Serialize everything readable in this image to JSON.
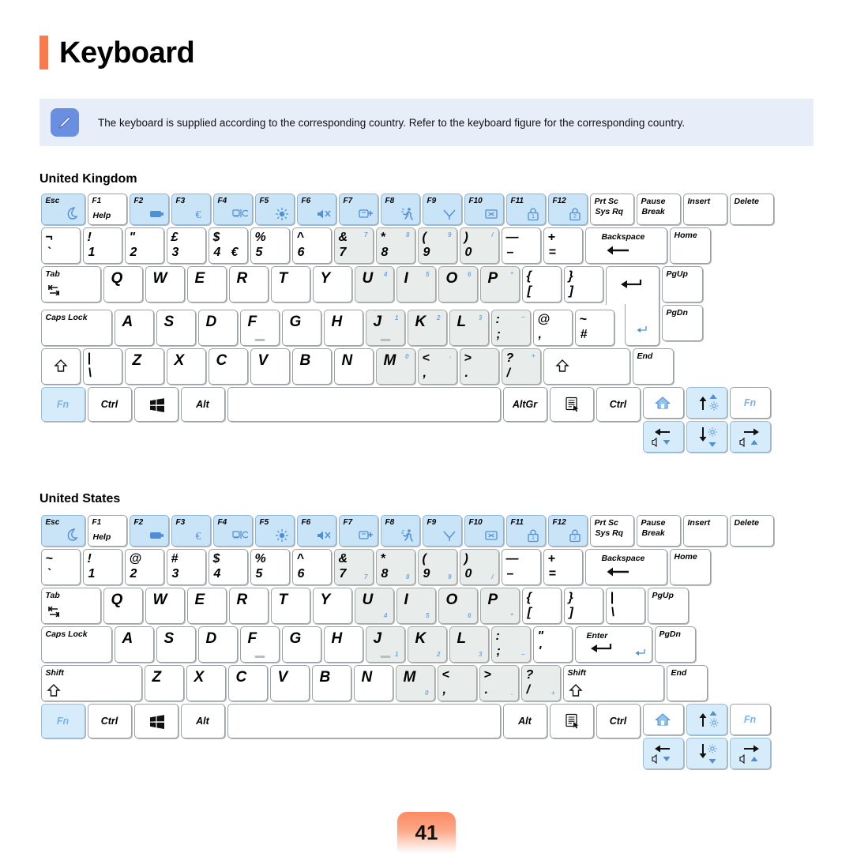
{
  "page": {
    "title": "Keyboard",
    "page_number": "41",
    "accent_color": "#f97a4d",
    "note_bg": "#e8eef9",
    "fn_key_color": "#c9e3f7",
    "numpad_key_color": "#e8ecea",
    "blue_label_color": "#6fa8e8"
  },
  "note": {
    "icon": "pencil-note-icon",
    "text": "The keyboard is supplied according to the corresponding country. Refer to the keyboard figure for the corresponding country."
  },
  "sections": [
    {
      "id": "uk",
      "title": "United Kingdom"
    },
    {
      "id": "us",
      "title": "United States"
    }
  ],
  "function_row": {
    "esc": {
      "top": "Esc",
      "icon": "moon-sleep-icon"
    },
    "keys": [
      {
        "top": "F1",
        "sub": "Help",
        "icon": "",
        "blue": false
      },
      {
        "top": "F2",
        "sub": "",
        "icon": "battery-icon",
        "blue": true
      },
      {
        "top": "F3",
        "sub": "",
        "icon": "euro-icon",
        "blue": true
      },
      {
        "top": "F4",
        "sub": "",
        "icon": "display-switch-icon",
        "blue": true
      },
      {
        "top": "F5",
        "sub": "",
        "icon": "brightness-icon",
        "blue": true
      },
      {
        "top": "F6",
        "sub": "",
        "icon": "mute-icon",
        "blue": true
      },
      {
        "top": "F7",
        "sub": "",
        "icon": "device-add-icon",
        "blue": true
      },
      {
        "top": "F8",
        "sub": "",
        "icon": "performance-runner-icon",
        "blue": true
      },
      {
        "top": "F9",
        "sub": "",
        "icon": "wireless-icon",
        "blue": true
      },
      {
        "top": "F10",
        "sub": "",
        "icon": "touchpad-off-icon",
        "blue": true
      },
      {
        "top": "F11",
        "sub": "",
        "icon": "lock-icon",
        "blue": true
      },
      {
        "top": "F12",
        "sub": "",
        "icon": "secure-lock-icon",
        "blue": true
      }
    ],
    "right": [
      {
        "l1": "Prt Sc",
        "l2": "Sys Rq"
      },
      {
        "l1": "Pause",
        "l2": "Break"
      },
      {
        "l1": "Insert",
        "l2": ""
      },
      {
        "l1": "Delete",
        "l2": ""
      }
    ]
  },
  "uk": {
    "row_num": [
      {
        "tl": "¬",
        "bl": "`",
        "bc": "¦",
        "grey": false
      },
      {
        "tl": "!",
        "bl": "1",
        "grey": false
      },
      {
        "tl": "\"",
        "bl": "2",
        "grey": false
      },
      {
        "tl": "£",
        "bl": "3",
        "grey": false
      },
      {
        "tl": "$",
        "bl": "4",
        "bx": "€",
        "grey": false
      },
      {
        "tl": "%",
        "bl": "5",
        "grey": false
      },
      {
        "tl": "^",
        "bl": "6",
        "grey": false
      },
      {
        "tl": "&",
        "bl": "7",
        "np": "7",
        "grey": true
      },
      {
        "tl": "*",
        "bl": "8",
        "np": "8",
        "grey": true
      },
      {
        "tl": "(",
        "bl": "9",
        "np": "9",
        "grey": true
      },
      {
        "tl": ")",
        "bl": "0",
        "np": "/",
        "grey": true
      },
      {
        "tl": "—",
        "bl": "–",
        "grey": false
      },
      {
        "tl": "+",
        "bl": "=",
        "grey": false
      }
    ],
    "backspace": "Backspace",
    "row_q": {
      "tab": "Tab",
      "keys": [
        {
          "c": "Q"
        },
        {
          "c": "W"
        },
        {
          "c": "E"
        },
        {
          "c": "R"
        },
        {
          "c": "T"
        },
        {
          "c": "Y"
        },
        {
          "c": "U",
          "np": "4",
          "grey": true
        },
        {
          "c": "I",
          "np": "5",
          "grey": true
        },
        {
          "c": "O",
          "np": "6",
          "grey": true
        },
        {
          "c": "P",
          "np": "*",
          "grey": true
        },
        {
          "tl": "{",
          "bl": "["
        },
        {
          "tl": "}",
          "bl": "]"
        }
      ]
    },
    "row_a": {
      "caps": "Caps Lock",
      "keys": [
        {
          "c": "A"
        },
        {
          "c": "S"
        },
        {
          "c": "D"
        },
        {
          "c": "F",
          "bump": true
        },
        {
          "c": "G"
        },
        {
          "c": "H"
        },
        {
          "c": "J",
          "np": "1",
          "grey": true,
          "bump": true
        },
        {
          "c": "K",
          "np": "2",
          "grey": true
        },
        {
          "c": "L",
          "np": "3",
          "grey": true
        },
        {
          "tl": ":",
          "bl": ";",
          "np": "−",
          "grey": true
        },
        {
          "tl": "@",
          "bl": ","
        },
        {
          "tl": "~",
          "bl": "#"
        }
      ]
    },
    "row_z": {
      "shift_icon": "shift-arrow-icon",
      "keys": [
        {
          "tl": "|",
          "bl": "\\"
        },
        {
          "c": "Z"
        },
        {
          "c": "X"
        },
        {
          "c": "C"
        },
        {
          "c": "V"
        },
        {
          "c": "B"
        },
        {
          "c": "N"
        },
        {
          "c": "M",
          "np": "0",
          "grey": true
        },
        {
          "tl": "<",
          "bl": ",",
          "np": ".",
          "grey": true
        },
        {
          "tl": ">",
          "bl": ".",
          "grey": true
        },
        {
          "tl": "?",
          "bl": "/",
          "np": "+",
          "grey": true
        }
      ],
      "rshift_icon": "shift-arrow-icon"
    },
    "row_bottom": {
      "fn": "Fn",
      "ctrl": "Ctrl",
      "win": "windows-logo-icon",
      "alt": "Alt",
      "space": "",
      "altgr": "AltGr",
      "menu": "context-menu-icon",
      "rctrl": "Ctrl",
      "fn_right": "Fn"
    },
    "nav_right": [
      "Home",
      "PgUp",
      "PgDn",
      "End"
    ],
    "arrows": {
      "home": "home-icon",
      "up": "arrow-up-brightness-up-icon",
      "left": "arrow-left-volume-down-icon",
      "down": "arrow-down-brightness-down-icon",
      "right": "arrow-right-volume-up-icon"
    }
  },
  "us": {
    "row_num": [
      {
        "tl": "~",
        "bl": "`",
        "grey": false
      },
      {
        "tl": "!",
        "bl": "1",
        "grey": false
      },
      {
        "tl": "@",
        "bl": "2",
        "grey": false
      },
      {
        "tl": "#",
        "bl": "3",
        "grey": false
      },
      {
        "tl": "$",
        "bl": "4",
        "grey": false
      },
      {
        "tl": "%",
        "bl": "5",
        "grey": false
      },
      {
        "tl": "^",
        "bl": "6",
        "grey": false
      },
      {
        "tl": "&",
        "bl": "7",
        "np": "7",
        "grey": true
      },
      {
        "tl": "*",
        "bl": "8",
        "np": "8",
        "grey": true
      },
      {
        "tl": "(",
        "bl": "9",
        "np": "9",
        "grey": true
      },
      {
        "tl": ")",
        "bl": "0",
        "np": "/",
        "grey": true
      },
      {
        "tl": "—",
        "bl": "–",
        "grey": false
      },
      {
        "tl": "+",
        "bl": "=",
        "grey": false
      }
    ],
    "backspace": "Backspace",
    "row_q": {
      "tab": "Tab",
      "keys": [
        {
          "c": "Q"
        },
        {
          "c": "W"
        },
        {
          "c": "E"
        },
        {
          "c": "R"
        },
        {
          "c": "T"
        },
        {
          "c": "Y"
        },
        {
          "c": "U",
          "np": "4",
          "grey": true
        },
        {
          "c": "I",
          "np": "5",
          "grey": true
        },
        {
          "c": "O",
          "np": "6",
          "grey": true
        },
        {
          "c": "P",
          "np": "*",
          "grey": true
        },
        {
          "tl": "{",
          "bl": "["
        },
        {
          "tl": "}",
          "bl": "]"
        },
        {
          "tl": "|",
          "bl": "\\"
        }
      ]
    },
    "row_a": {
      "caps": "Caps Lock",
      "keys": [
        {
          "c": "A"
        },
        {
          "c": "S"
        },
        {
          "c": "D"
        },
        {
          "c": "F",
          "bump": true
        },
        {
          "c": "G"
        },
        {
          "c": "H"
        },
        {
          "c": "J",
          "np": "1",
          "grey": true,
          "bump": true
        },
        {
          "c": "K",
          "np": "2",
          "grey": true
        },
        {
          "c": "L",
          "np": "3",
          "grey": true
        },
        {
          "tl": ":",
          "bl": ";",
          "np": "−",
          "grey": true
        },
        {
          "tl": "\"",
          "bl": "'"
        }
      ],
      "enter": "Enter"
    },
    "row_z": {
      "shift": "Shift",
      "keys": [
        {
          "c": "Z"
        },
        {
          "c": "X"
        },
        {
          "c": "C"
        },
        {
          "c": "V"
        },
        {
          "c": "B"
        },
        {
          "c": "N"
        },
        {
          "c": "M",
          "np": "0",
          "grey": true
        },
        {
          "tl": "<",
          "bl": ",",
          "grey": true
        },
        {
          "tl": ">",
          "bl": ".",
          "np": ".",
          "grey": true
        },
        {
          "tl": "?",
          "bl": "/",
          "np": "+",
          "grey": true
        }
      ],
      "rshift": "Shift"
    },
    "row_bottom": {
      "fn": "Fn",
      "ctrl": "Ctrl",
      "win": "windows-logo-icon",
      "alt": "Alt",
      "space": "",
      "ralt": "Alt",
      "menu": "context-menu-icon",
      "rctrl": "Ctrl",
      "fn_right": "Fn"
    },
    "nav_right": [
      "Home",
      "PgUp",
      "PgDn",
      "End"
    ],
    "arrows": {
      "home": "home-icon",
      "up": "arrow-up-brightness-up-icon",
      "left": "arrow-left-volume-down-icon",
      "down": "arrow-down-brightness-down-icon",
      "right": "arrow-right-volume-up-icon"
    }
  }
}
